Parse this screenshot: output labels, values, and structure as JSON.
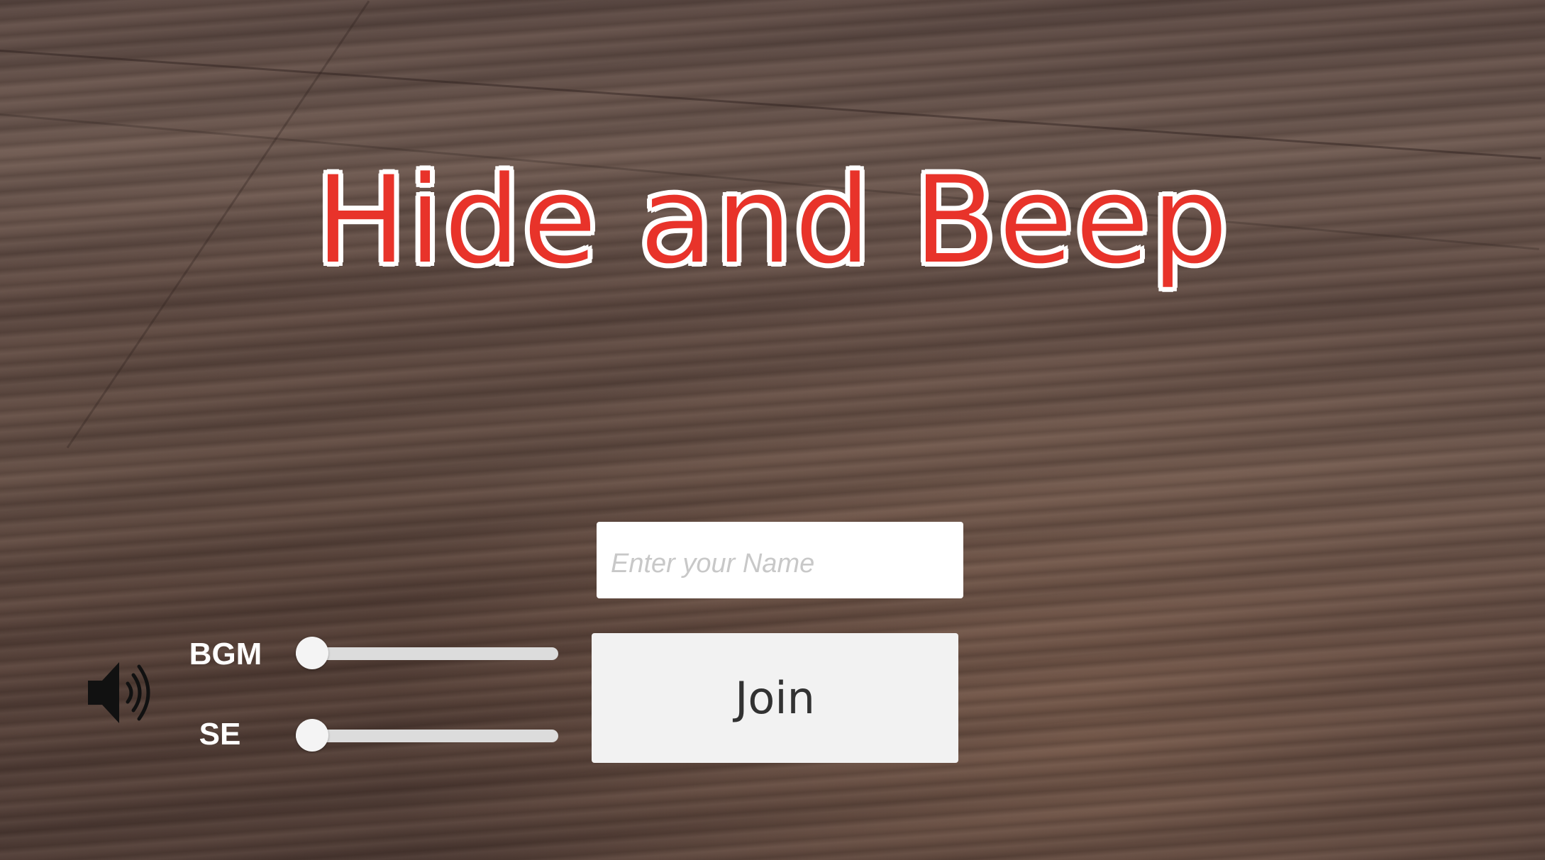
{
  "game": {
    "title": "Hide and Beep"
  },
  "login": {
    "name_placeholder": "Enter your Name",
    "name_value": "",
    "join_label": "Join"
  },
  "audio": {
    "icon": "speaker-icon",
    "sliders": [
      {
        "label": "BGM",
        "value": 0.0
      },
      {
        "label": "SE",
        "value": 0.0
      }
    ]
  },
  "colors": {
    "title_fill": "#e8332a",
    "title_outline": "#ffffff",
    "button_bg": "#f2f2f2",
    "input_bg": "#ffffff"
  }
}
